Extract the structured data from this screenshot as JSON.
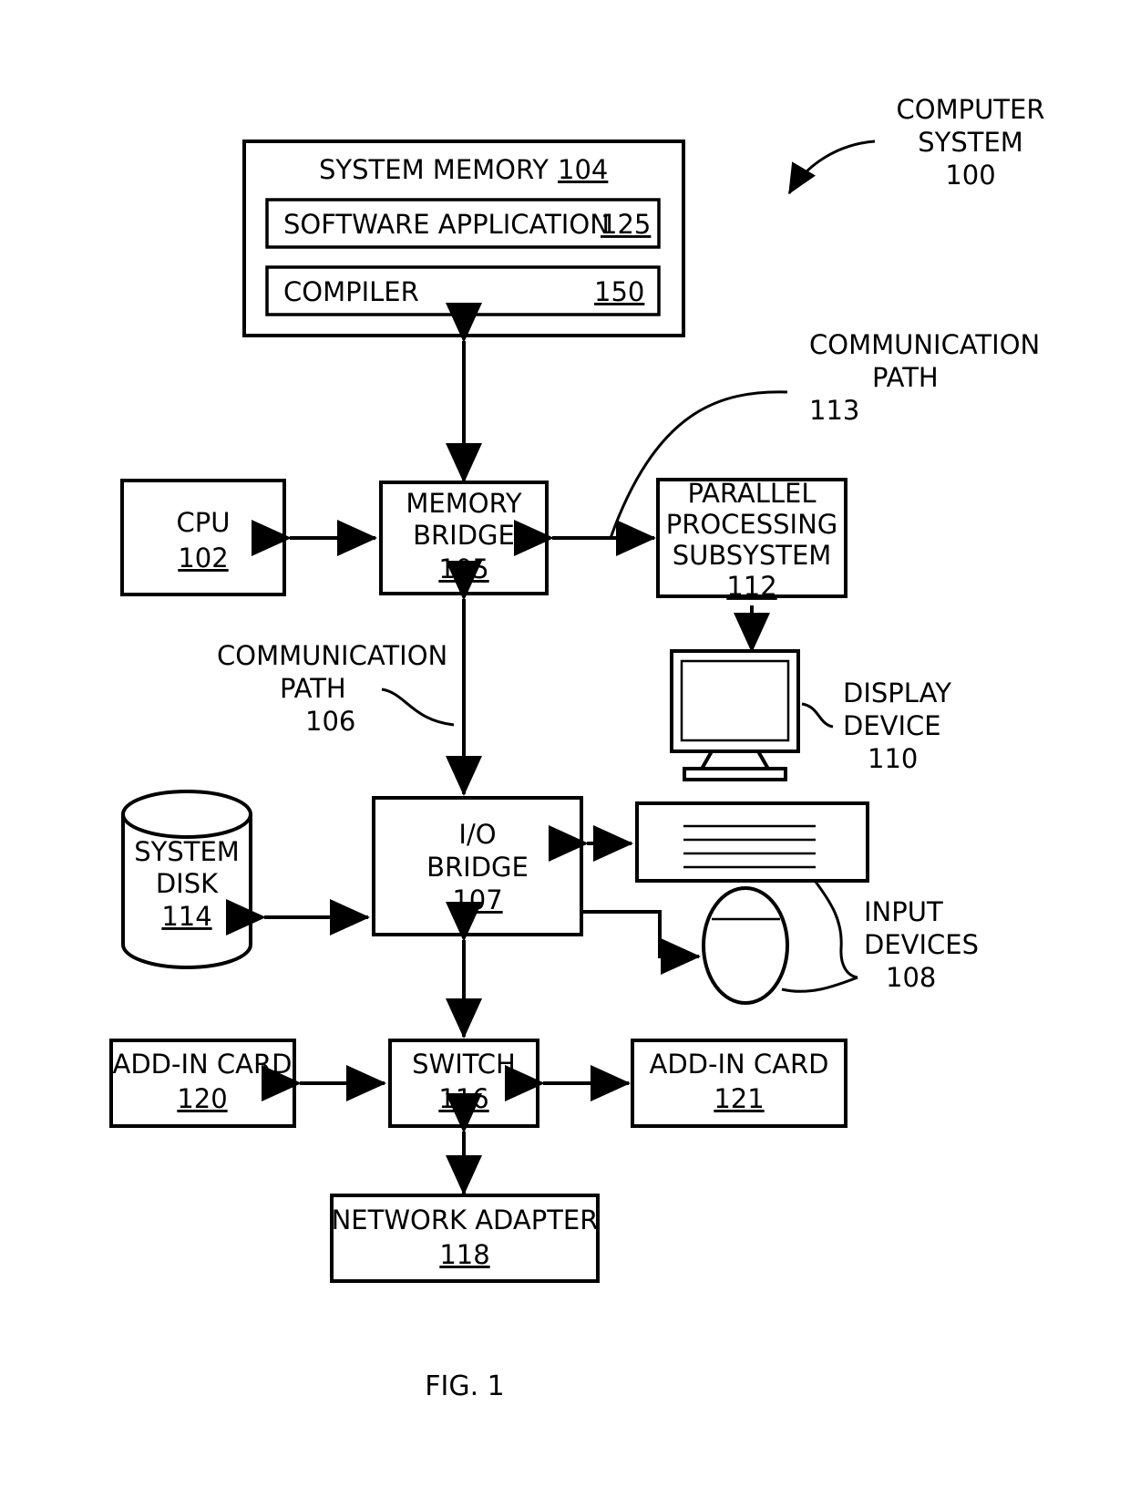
{
  "figure": {
    "caption": "FIG. 1",
    "title_label": {
      "line1": "COMPUTER",
      "line2": "SYSTEM",
      "ref": "100"
    }
  },
  "blocks": {
    "system_memory": {
      "label": "SYSTEM MEMORY",
      "ref": "104"
    },
    "software_application": {
      "label": "SOFTWARE APPLICATION",
      "ref": "125"
    },
    "compiler": {
      "label": "COMPILER",
      "ref": "150"
    },
    "cpu": {
      "label": "CPU",
      "ref": "102"
    },
    "memory_bridge": {
      "line1": "MEMORY",
      "line2": "BRIDGE",
      "ref": "105"
    },
    "parallel_processing_subsystem": {
      "line1": "PARALLEL",
      "line2": "PROCESSING",
      "line3": "SUBSYSTEM",
      "ref": "112"
    },
    "display_device": {
      "line1": "DISPLAY",
      "line2": "DEVICE",
      "ref": "110"
    },
    "system_disk": {
      "line1": "SYSTEM",
      "line2": "DISK",
      "ref": "114"
    },
    "io_bridge": {
      "line1": "I/O",
      "line2": "BRIDGE",
      "ref": "107"
    },
    "input_devices": {
      "line1": "INPUT",
      "line2": "DEVICES",
      "ref": "108"
    },
    "add_in_card_left": {
      "label": "ADD-IN CARD",
      "ref": "120"
    },
    "switch": {
      "label": "SWITCH",
      "ref": "116"
    },
    "add_in_card_right": {
      "label": "ADD-IN CARD",
      "ref": "121"
    },
    "network_adapter": {
      "label": "NETWORK ADAPTER",
      "ref": "118"
    }
  },
  "paths": {
    "comm_path_113": {
      "line1": "COMMUNICATION",
      "line2": "PATH",
      "ref": "113"
    },
    "comm_path_106": {
      "line1": "COMMUNICATION",
      "line2": "PATH",
      "ref": "106"
    }
  },
  "colors": {
    "stroke": "#000000",
    "background": "#ffffff"
  }
}
